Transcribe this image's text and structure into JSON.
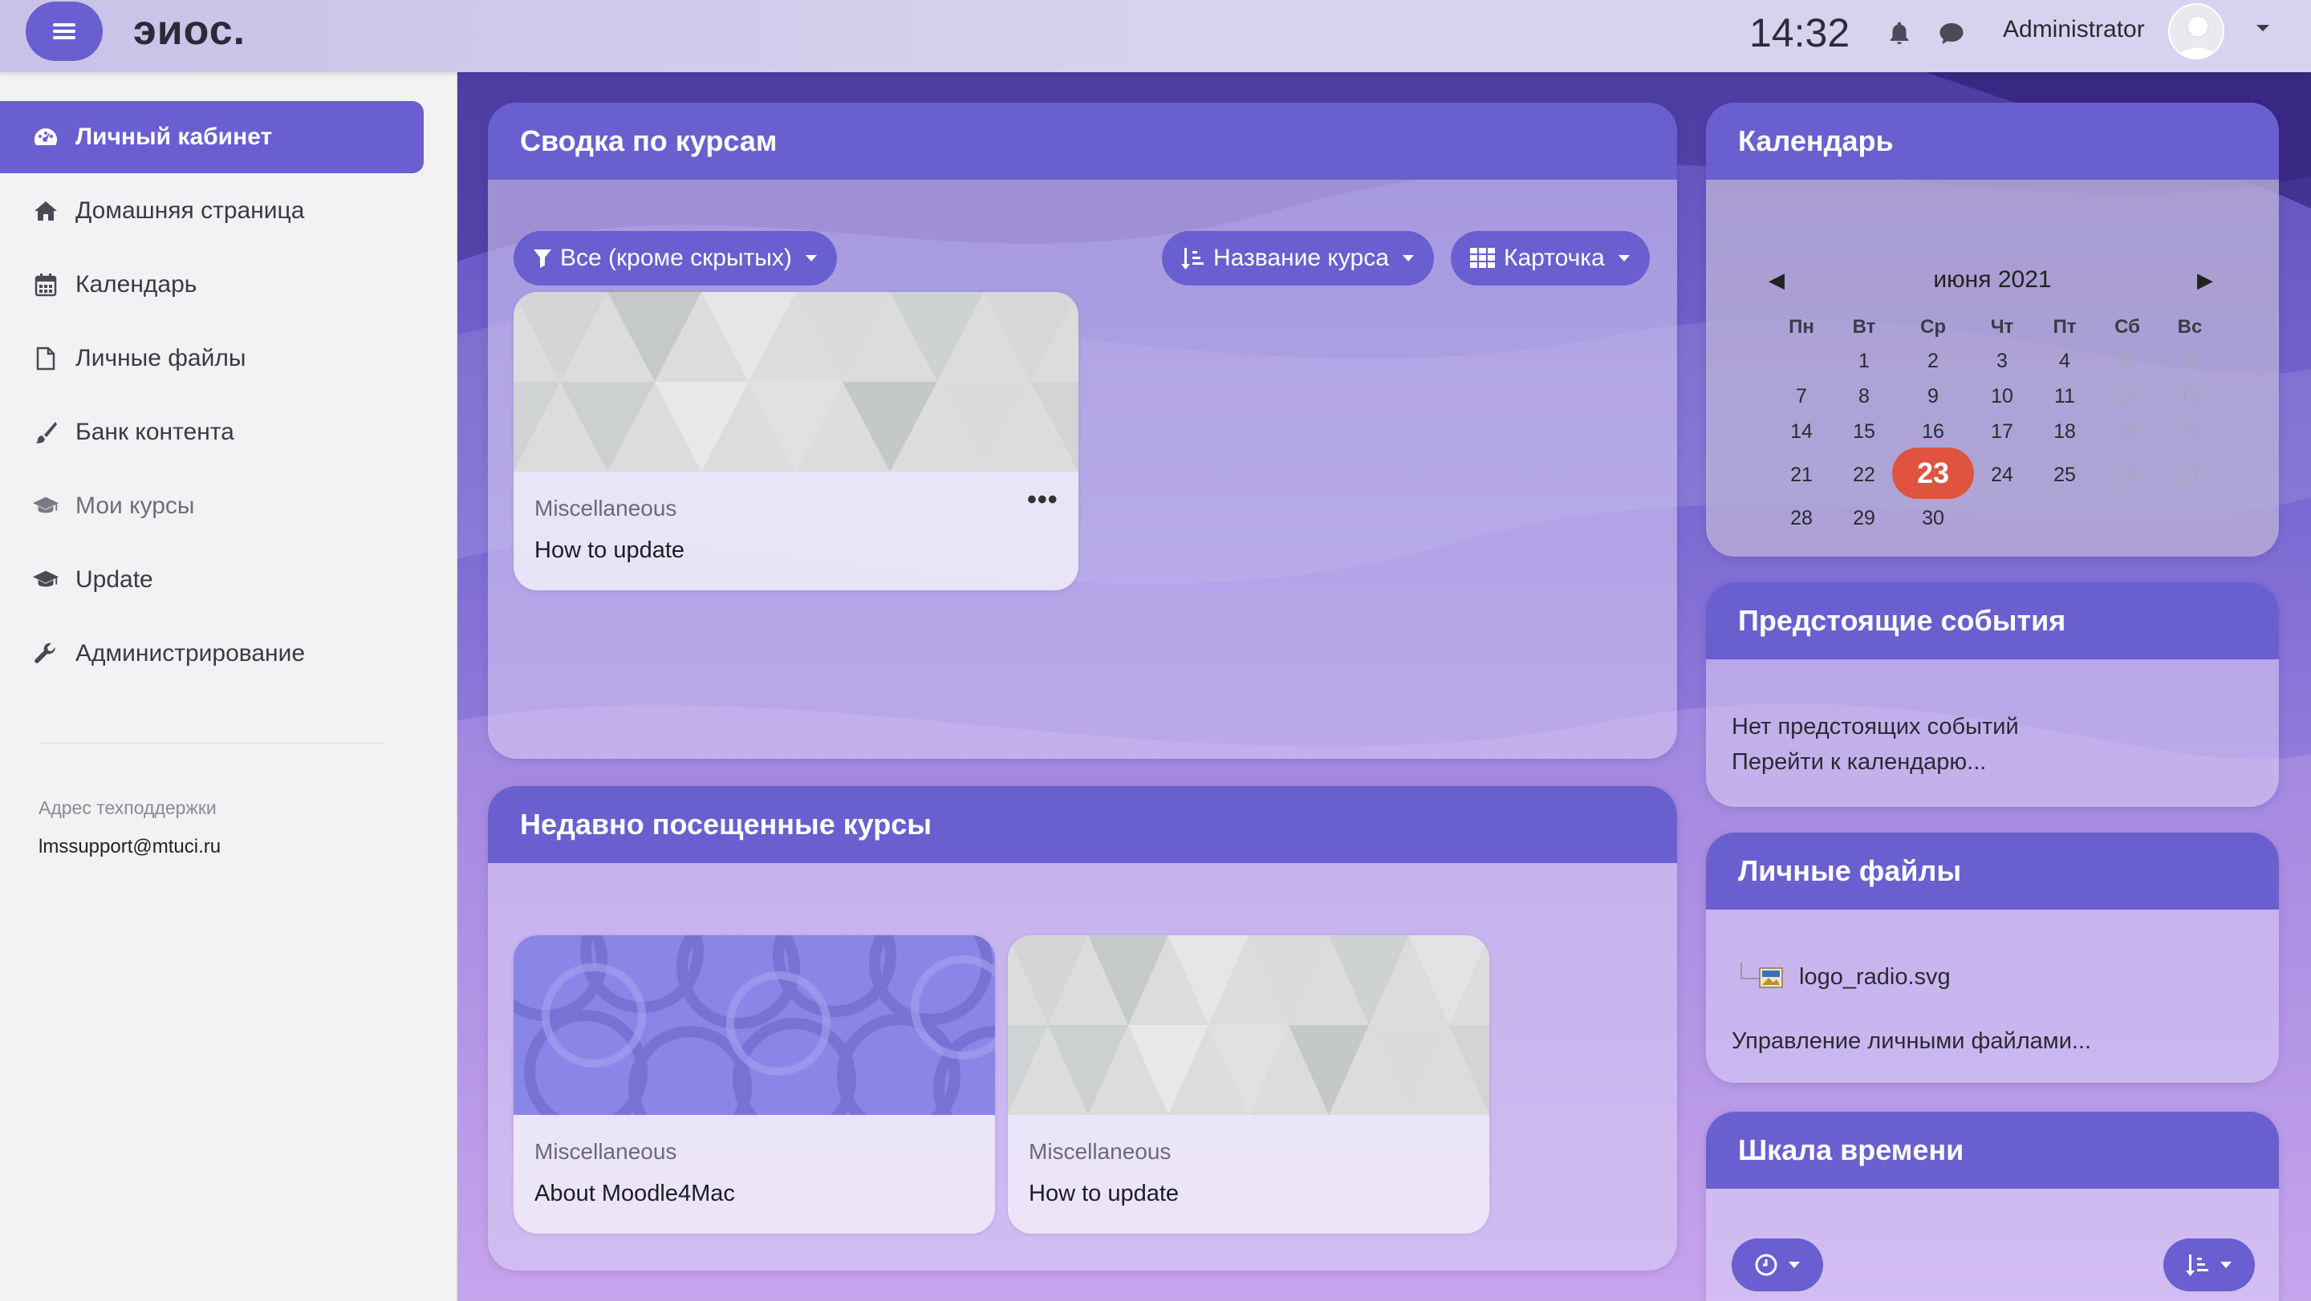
{
  "brand": "эиос.",
  "navbar": {
    "time": "14:32",
    "user_name": "Administrator",
    "icons": {
      "menu": "menu-icon",
      "bell": "bell-icon",
      "chat": "chat-icon",
      "user": "user-avatar-icon",
      "caret": "caret-down-icon"
    }
  },
  "sidebar": {
    "items": [
      {
        "label": "Личный кабинет",
        "icon": "dashboard-icon",
        "active": true
      },
      {
        "label": "Домашняя страница",
        "icon": "home-icon"
      },
      {
        "label": "Календарь",
        "icon": "calendar-icon"
      },
      {
        "label": "Личные файлы",
        "icon": "file-icon"
      },
      {
        "label": "Банк контента",
        "icon": "brush-icon"
      },
      {
        "label": "Мои курсы",
        "icon": "graduation-cap-icon"
      },
      {
        "label": "Update",
        "icon": "graduation-cap-icon"
      },
      {
        "label": "Администрирование",
        "icon": "wrench-icon"
      }
    ],
    "support_label": "Адрес техподдержки",
    "support_email": "lmssupport@mtuci.ru"
  },
  "course_overview": {
    "title": "Сводка по курсам",
    "filter_label": "Все (кроме скрытых)",
    "sort_label": "Название курса",
    "view_label": "Карточка",
    "courses": [
      {
        "category": "Miscellaneous",
        "name": "How to update",
        "menu": "•••"
      }
    ]
  },
  "recent_courses": {
    "title": "Недавно посещенные курсы",
    "courses": [
      {
        "category": "Miscellaneous",
        "name": "About Moodle4Mac"
      },
      {
        "category": "Miscellaneous",
        "name": "How to update"
      }
    ]
  },
  "calendar": {
    "title": "Календарь",
    "month": "июня 2021",
    "prev": "◀",
    "next": "▶",
    "weekdays": [
      "Пн",
      "Вт",
      "Ср",
      "Чт",
      "Пт",
      "Сб",
      "Вс"
    ],
    "weeks": [
      [
        "",
        "1",
        "2",
        "3",
        "4",
        "5",
        "6"
      ],
      [
        "7",
        "8",
        "9",
        "10",
        "11",
        "12",
        "13"
      ],
      [
        "14",
        "15",
        "16",
        "17",
        "18",
        "19",
        "20"
      ],
      [
        "21",
        "22",
        "23",
        "24",
        "25",
        "26",
        "27"
      ],
      [
        "28",
        "29",
        "30",
        "",
        "",
        "",
        ""
      ]
    ],
    "today": "23"
  },
  "upcoming_events": {
    "title": "Предстоящие события",
    "empty_text": "Нет предстоящих событий",
    "link": "Перейти к календарю..."
  },
  "private_files": {
    "title": "Личные файлы",
    "file_name": "logo_radio.svg",
    "manage_link": "Управление личными файлами..."
  },
  "timeline": {
    "title": "Шкала времени",
    "icons": {
      "filter": "clock-icon",
      "sort": "sort-icon"
    }
  }
}
